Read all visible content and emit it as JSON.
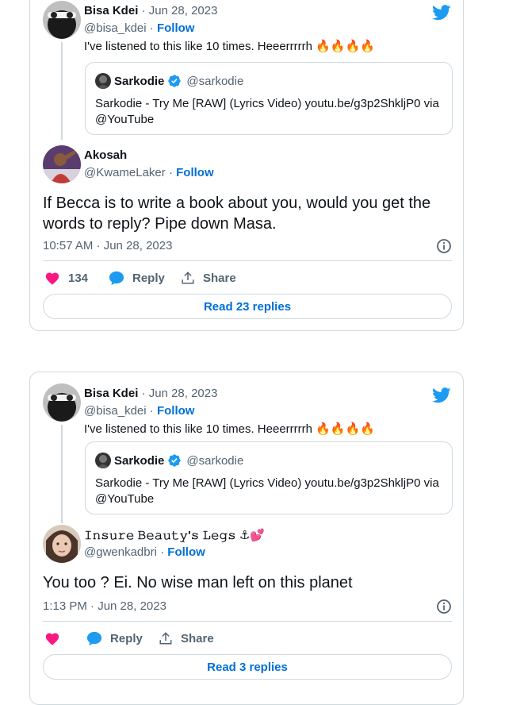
{
  "tweets": [
    {
      "parent": {
        "name": "Bisa Kdei",
        "separator": " · ",
        "date": "Jun 28, 2023",
        "handle": "@bisa_kdei",
        "dot": " · ",
        "follow": "Follow",
        "text": "I've listened to this like 10 times.  Heeerrrrrh 🔥🔥🔥🔥"
      },
      "quote": {
        "name": "Sarkodie",
        "handle": "@sarkodie",
        "text": "Sarkodie - Try Me [RAW]  (Lyrics Video) youtu.be/g3p2ShkljP0 via @YouTube"
      },
      "reply": {
        "name": "Akosah",
        "handle": "@KwameLaker",
        "dot": " · ",
        "follow": "Follow",
        "text": "If Becca is to write a book about you, would you get the words to reply? Pipe down Masa.",
        "timestamp": "10:57 AM · Jun 28, 2023",
        "likes": "134",
        "reply_label": "Reply",
        "share_label": "Share",
        "read_replies": "Read 23 replies"
      }
    },
    {
      "parent": {
        "name": "Bisa Kdei",
        "separator": " · ",
        "date": "Jun 28, 2023",
        "handle": "@bisa_kdei",
        "dot": " · ",
        "follow": "Follow",
        "text": "I've listened to this like 10 times.  Heeerrrrrh 🔥🔥🔥🔥"
      },
      "quote": {
        "name": "Sarkodie",
        "handle": "@sarkodie",
        "text": "Sarkodie - Try Me [RAW]  (Lyrics Video) youtu.be/g3p2ShkljP0 via @YouTube"
      },
      "reply": {
        "name": "𝙸𝚗𝚜𝚞𝚛𝚎 𝙱𝚎𝚊𝚞𝚝𝚢'𝚜 𝙻𝚎𝚐𝚜 ⚓💕",
        "handle": "@gwenkadbri",
        "dot": " · ",
        "follow": "Follow",
        "text": "You too ? Ei. No wise man left on this planet",
        "timestamp": "1:13 PM · Jun 28, 2023",
        "likes": "",
        "reply_label": "Reply",
        "share_label": "Share",
        "read_replies": "Read 3 replies"
      }
    }
  ],
  "colors": {
    "like_pink": "#f91880",
    "reply_blue": "#1d9bf0",
    "twitter_blue": "#1d9bf0",
    "link_blue": "#006fd6",
    "verified_blue": "#1d9bf0"
  },
  "icons": {
    "brand": "twitter-bird-icon",
    "verified": "verified-badge-icon",
    "like": "heart-icon",
    "reply": "speech-bubble-icon",
    "share": "share-icon",
    "info": "info-icon"
  }
}
